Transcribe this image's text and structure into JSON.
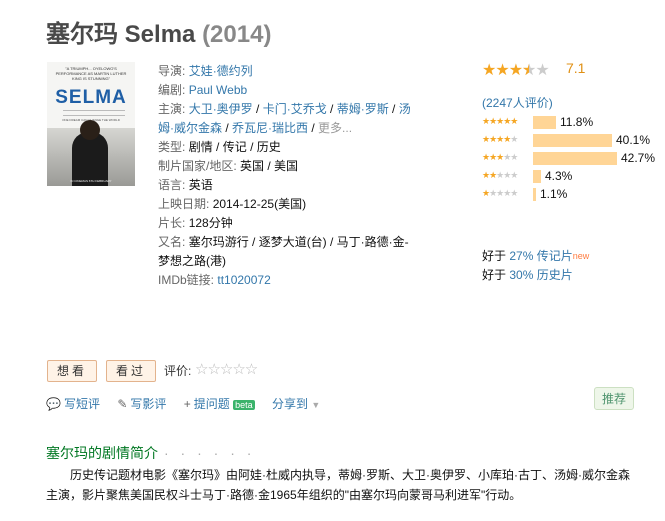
{
  "title": {
    "name": "塞尔玛 Selma",
    "year": "(2014)"
  },
  "poster": {
    "quote": "\"A TRIUMPH... OYELOWO'S PERFORMANCE AS MARTIN LUTHER KING IS STUNNING\"",
    "logo": "SELMA",
    "tagline": "ONE DREAM CAN CHANGE THE WORLD",
    "bottom_text": "IN CINEMAS 6TH FEBRUARY"
  },
  "info": {
    "director_label": "导演:",
    "director": "艾娃·德约列",
    "writer_label": "编剧:",
    "writer": "Paul Webb",
    "cast_label": "主演:",
    "cast": [
      "大卫·奥伊罗",
      "卡门·艾乔戈",
      "蒂姆·罗斯",
      "汤姆·威尔金森",
      "乔瓦尼·瑞比西"
    ],
    "cast_more": "更多...",
    "genre_label": "类型:",
    "genres": [
      "剧情",
      "传记",
      "历史"
    ],
    "country_label": "制片国家/地区:",
    "country": "英国 / 美国",
    "language_label": "语言:",
    "language": "英语",
    "release_label": "上映日期:",
    "release": "2014-12-25(美国)",
    "runtime_label": "片长:",
    "runtime": "128分钟",
    "aka_label": "又名:",
    "aka": "塞尔玛游行 / 逐梦大道(台) / 马丁·路德·金-梦想之路(港)",
    "imdb_label": "IMDb链接:",
    "imdb": "tt1020072"
  },
  "rating": {
    "score": "7.1",
    "stars": 3.5,
    "votes": "(2247人评价)",
    "distribution": [
      {
        "stars": 5,
        "pct_label": "11.8%",
        "pct": 11.8
      },
      {
        "stars": 4,
        "pct_label": "40.1%",
        "pct": 40.1
      },
      {
        "stars": 3,
        "pct_label": "42.7%",
        "pct": 42.7
      },
      {
        "stars": 2,
        "pct_label": "4.3%",
        "pct": 4.3
      },
      {
        "stars": 1,
        "pct_label": "1.1%",
        "pct": 1.1
      }
    ],
    "better_than": [
      {
        "prefix": "好于 ",
        "pct": "27%",
        "cat": "传记片",
        "badge": "new"
      },
      {
        "prefix": "好于 ",
        "pct": "30%",
        "cat": "历史片",
        "badge": ""
      }
    ]
  },
  "actions": {
    "want_to_see": "想看",
    "seen": "看过",
    "rate_label": "评价:",
    "write_short": "写短评",
    "write_review": "写影评",
    "ask_question": "提问题",
    "beta": "beta",
    "share": "分享到",
    "recommend": "推荐"
  },
  "synopsis": {
    "title": "塞尔玛的剧情简介",
    "dots": "· · · · · ·",
    "text": "历史传记题材电影《塞尔玛》由阿娃·杜威内执导，蒂姆·罗斯、大卫·奥伊罗、小库珀·古丁、汤姆·威尔金森主演，影片聚焦美国民权斗士马丁·路德·金1965年组织的\"由塞尔玛向蒙哥马利进军\"行动。"
  }
}
